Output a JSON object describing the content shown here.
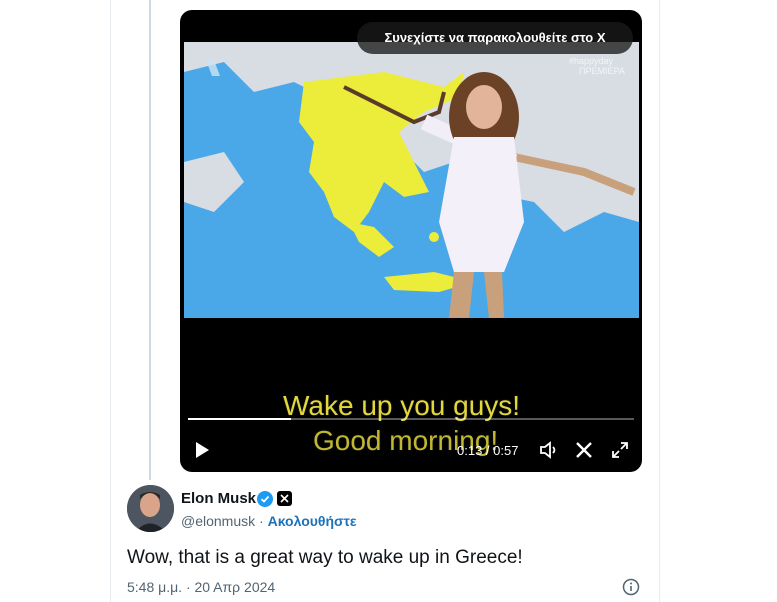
{
  "video": {
    "banner_text": "Συνεχίστε να παρακολουθείτε στο X",
    "watermark": "#happyday\nΠΡΕΜΙΕΡΑ",
    "subtitle_line1": "Wake up you guys!",
    "subtitle_line2": "Good morning!",
    "time_display": "0:13 / 0:57",
    "progress_fraction": 0.23,
    "colors": {
      "sea": "#4aa8e8",
      "land": "#d8dde4",
      "greece": "#ecec3a",
      "subtitle": "#e3d83a"
    }
  },
  "author": {
    "name": "Elon Musk",
    "handle": "@elonmusk",
    "separator": "·",
    "follow_label": "Ακολουθήστε",
    "verified_color": "#1d9bf0"
  },
  "tweet": {
    "text": "Wow, that is a great way to wake up in Greece!",
    "timestamp": "5:48 μ.μ. · 20 Απρ 2024"
  },
  "icons": [
    "play-icon",
    "volume-icon",
    "x-logo-icon",
    "fullscreen-icon",
    "verified-icon",
    "info-icon"
  ]
}
